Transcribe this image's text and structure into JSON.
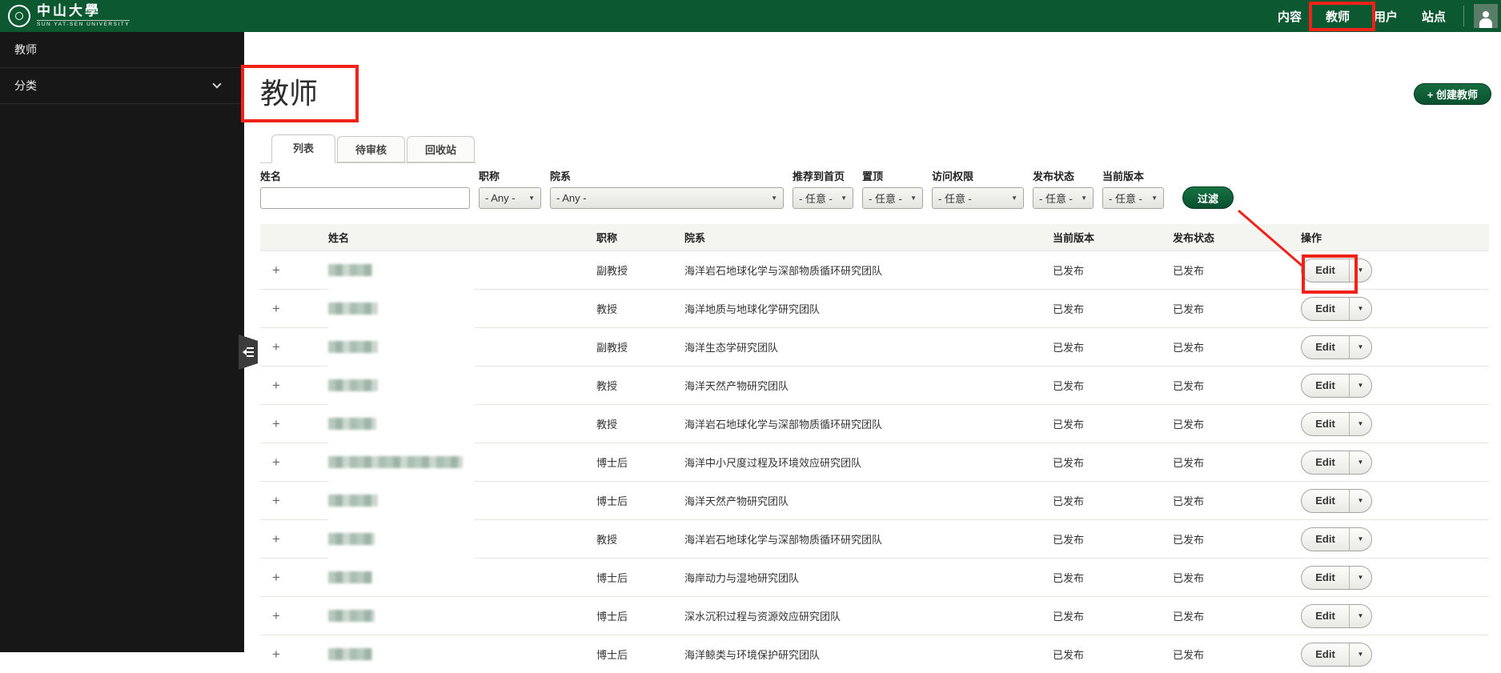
{
  "app": {
    "logo_title": "中山大學",
    "logo_subtitle": "SUN YAT-SEN UNIVERSITY"
  },
  "top_nav": {
    "items": [
      "内容",
      "教师",
      "用户",
      "站点"
    ]
  },
  "sidebar": {
    "items": [
      "教师",
      "分类"
    ]
  },
  "page": {
    "title": "教师",
    "create_button_label": "+ 创建教师",
    "tabs": [
      "列表",
      "待审核",
      "回收站"
    ],
    "filters": {
      "name_label": "姓名",
      "name_value": "",
      "title_label": "职称",
      "title_value": "- Any -",
      "dept_label": "院系",
      "dept_value": "- Any -",
      "promote_label": "推荐到首页",
      "promote_value": "- 任意 -",
      "sticky_label": "置顶",
      "sticky_value": "- 任意 -",
      "access_label": "访问权限",
      "access_value": "- 任意 -",
      "status_label": "发布状态",
      "status_value": "- 任意 -",
      "version_label": "当前版本",
      "version_value": "- 任意 -",
      "submit_label": "过滤"
    },
    "table": {
      "headers": [
        "姓名",
        "职称",
        "院系",
        "当前版本",
        "发布状态",
        "操作"
      ],
      "edit_label": "Edit",
      "rows": [
        {
          "title": "副教授",
          "dept": "海洋岩石地球化学与深部物质循环研究团队",
          "version": "已发布",
          "status": "已发布",
          "name_width": 55
        },
        {
          "title": "教授",
          "dept": "海洋地质与地球化学研究团队",
          "version": "已发布",
          "status": "已发布",
          "name_width": 62
        },
        {
          "title": "副教授",
          "dept": "海洋生态学研究团队",
          "version": "已发布",
          "status": "已发布",
          "name_width": 62
        },
        {
          "title": "教授",
          "dept": "海洋天然产物研究团队",
          "version": "已发布",
          "status": "已发布",
          "name_width": 62
        },
        {
          "title": "教授",
          "dept": "海洋岩石地球化学与深部物质循环研究团队",
          "version": "已发布",
          "status": "已发布",
          "name_width": 60
        },
        {
          "title": "博士后",
          "dept": "海洋中小尺度过程及环境效应研究团队",
          "version": "已发布",
          "status": "已发布",
          "name_width": 168
        },
        {
          "title": "博士后",
          "dept": "海洋天然产物研究团队",
          "version": "已发布",
          "status": "已发布",
          "name_width": 62
        },
        {
          "title": "教授",
          "dept": "海洋岩石地球化学与深部物质循环研究团队",
          "version": "已发布",
          "status": "已发布",
          "name_width": 58
        },
        {
          "title": "博士后",
          "dept": "海岸动力与湿地研究团队",
          "version": "已发布",
          "status": "已发布",
          "name_width": 55
        },
        {
          "title": "博士后",
          "dept": "深水沉积过程与资源效应研究团队",
          "version": "已发布",
          "status": "已发布",
          "name_width": 58
        },
        {
          "title": "博士后",
          "dept": "海洋鲸类与环境保护研究团队",
          "version": "已发布",
          "status": "已发布",
          "name_width": 55
        }
      ]
    }
  },
  "colors": {
    "header_green": "#0c5931",
    "button_green": "#0f6a3c",
    "sidebar_bg": "#171717",
    "annotation_red": "#ee2218"
  }
}
